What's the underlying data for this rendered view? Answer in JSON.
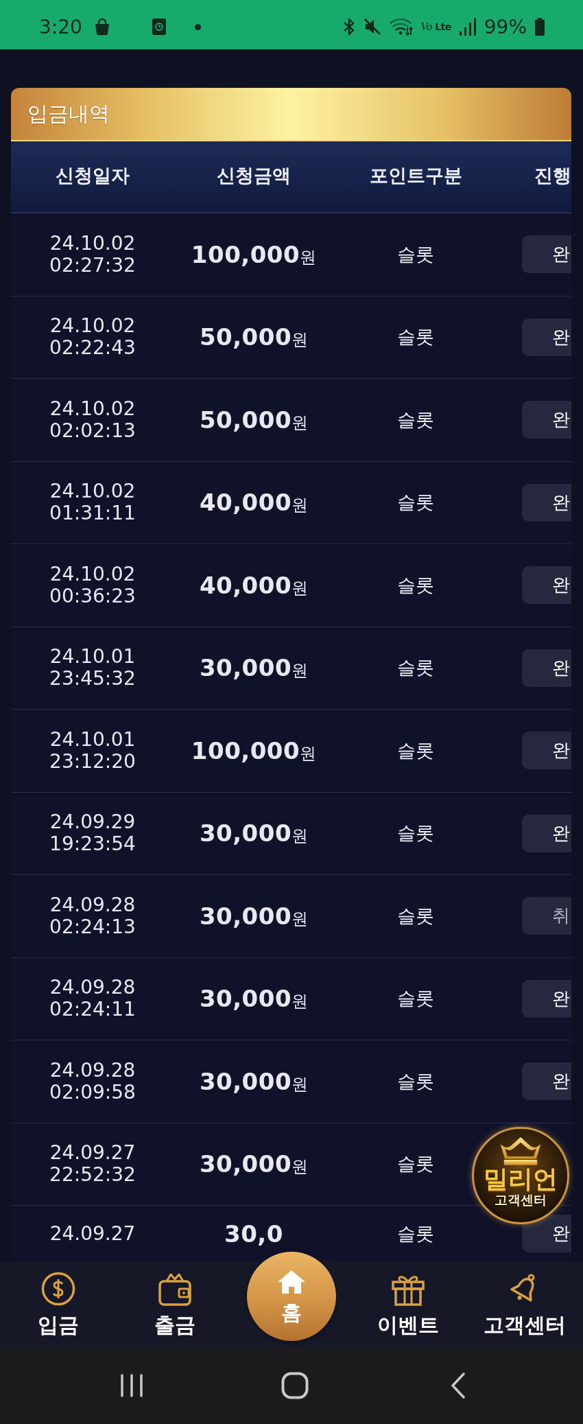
{
  "status_bar": {
    "time": "3:20",
    "network": "*Vo* Lte",
    "battery": "99%"
  },
  "deposit_panel": {
    "title": "입금내역",
    "columns": [
      "신청일자",
      "신청금액",
      "포인트구분",
      "진행"
    ],
    "rows": [
      {
        "date": "24.10.02",
        "time": "02:27:32",
        "amount": "**100,000**원",
        "point": "슬롯",
        "status": {
          "text": "완",
          "kind": "done"
        }
      },
      {
        "date": "24.10.02",
        "time": "02:22:43",
        "amount": "**50,000**원",
        "point": "슬롯",
        "status": {
          "text": "완",
          "kind": "done"
        }
      },
      {
        "date": "24.10.02",
        "time": "02:02:13",
        "amount": "**50,000**원",
        "point": "슬롯",
        "status": {
          "text": "완",
          "kind": "done"
        }
      },
      {
        "date": "24.10.02",
        "time": "01:31:11",
        "amount": "**40,000**원",
        "point": "슬롯",
        "status": {
          "text": "완",
          "kind": "done"
        }
      },
      {
        "date": "24.10.02",
        "time": "00:36:23",
        "amount": "**40,000**원",
        "point": "슬롯",
        "status": {
          "text": "완",
          "kind": "done"
        }
      },
      {
        "date": "24.10.01",
        "time": "23:45:32",
        "amount": "**30,000**원",
        "point": "슬롯",
        "status": {
          "text": "완",
          "kind": "done"
        }
      },
      {
        "date": "24.10.01",
        "time": "23:12:20",
        "amount": "**100,000**원",
        "point": "슬롯",
        "status": {
          "text": "완",
          "kind": "done"
        }
      },
      {
        "date": "24.09.29",
        "time": "19:23:54",
        "amount": "**30,000**원",
        "point": "슬롯",
        "status": {
          "text": "완",
          "kind": "done"
        }
      },
      {
        "date": "24.09.28",
        "time": "02:24:13",
        "amount": "**30,000**원",
        "point": "슬롯",
        "status": {
          "text": "취",
          "kind": "cancelled"
        }
      },
      {
        "date": "24.09.28",
        "time": "02:24:11",
        "amount": "**30,000**원",
        "point": "슬롯",
        "status": {
          "text": "완",
          "kind": "done"
        }
      },
      {
        "date": "24.09.28",
        "time": "02:09:58",
        "amount": "**30,000**원",
        "point": "슬롯",
        "status": {
          "text": "완",
          "kind": "done"
        }
      },
      {
        "date": "24.09.27",
        "time": "22:52:32",
        "amount": "**30,000**원",
        "point": "슬롯"
      },
      {
        "date": "24.09.27",
        "amount": "**30,0**",
        "point": "슬롯",
        "status": {
          "text": "완",
          "kind": "done"
        }
      }
    ]
  },
  "support_badge": {
    "title": "밀리언",
    "subtitle": "고객센터"
  },
  "bottom_nav": [
    {
      "label": "입금",
      "kind": "regular"
    },
    {
      "label": "출금",
      "kind": "regular"
    },
    {
      "label": "홈",
      "kind": "center"
    },
    {
      "label": "이벤트",
      "kind": "regular"
    },
    {
      "label": "고객센터",
      "kind": "regular"
    }
  ]
}
